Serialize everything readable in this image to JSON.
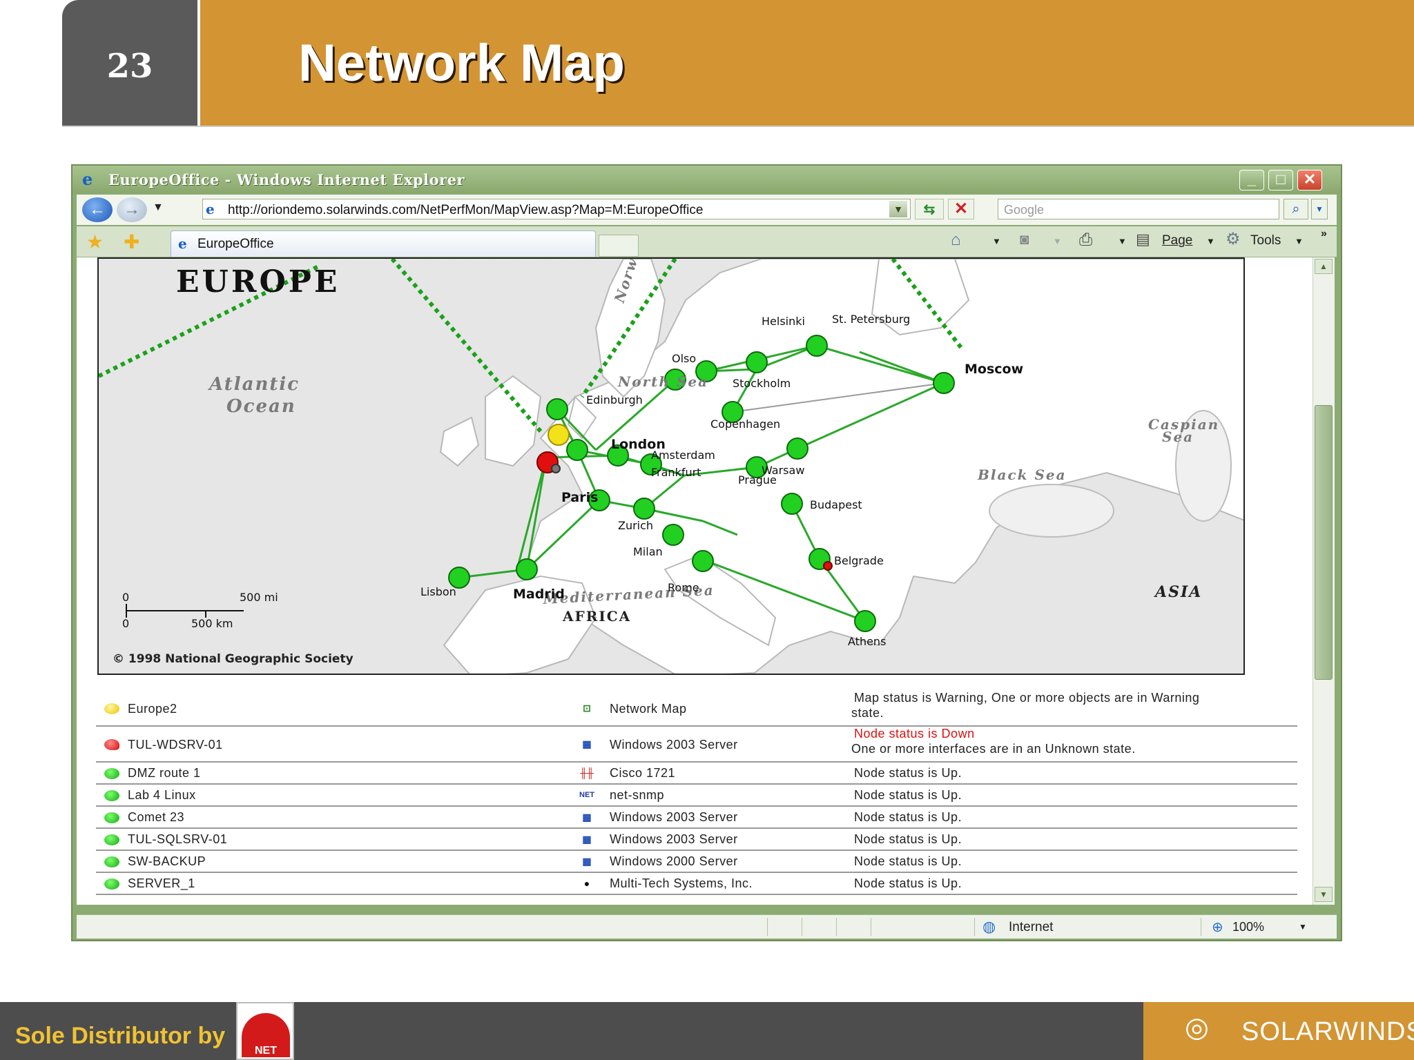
{
  "slide": {
    "number": "23",
    "title": "Network Map",
    "footer_text": "Sole Distributor by",
    "footer_logo_text": "NET",
    "brand": "SOLARWINDS",
    "colors": {
      "header": "#d39433",
      "dark": "#4d4d4d",
      "footer_text": "#f1c232"
    }
  },
  "browser": {
    "window_title": "EuropeOffice - Windows Internet Explorer",
    "url": "http://oriondemo.solarwinds.com/NetPerfMon/MapView.asp?Map=M:EuropeOffice",
    "search_placeholder": "Google",
    "tab_label": "EuropeOffice",
    "commands": {
      "page": "Page",
      "tools": "Tools",
      "more": "»"
    },
    "status": {
      "zone": "Internet",
      "zoom": "100%"
    }
  },
  "map": {
    "title": "EUROPE",
    "copyright": "© 1998 National Geographic Society",
    "scale": {
      "mi_zero": "0",
      "mi": "500 mi",
      "km_zero": "0",
      "km": "500 km"
    },
    "seas": [
      "Atlantic",
      "Ocean",
      "Norwegian Sea",
      "North Sea",
      "Caspian",
      "Sea",
      "Black Sea",
      "Mediterranean Sea",
      "AFRICA",
      "ASIA"
    ],
    "cities": {
      "edinburgh": "Edinburgh",
      "london": "London",
      "amsterdam": "Amsterdam",
      "frankfurt": "Frankfurt",
      "paris": "Paris",
      "zurich": "Zurich",
      "milan": "Milan",
      "rome": "Rome",
      "madrid": "Madrid",
      "lisbon": "Lisbon",
      "olso": "Olso",
      "stockholm": "Stockholm",
      "helsinki": "Helsinki",
      "st_petersburg": "St. Petersburg",
      "moscow": "Moscow",
      "copenhagen": "Copenhagen",
      "warsaw": "Warsaw",
      "prague": "Prague",
      "budapest": "Budapest",
      "belgrade": "Belgrade",
      "athens": "Athens"
    }
  },
  "nodes": [
    {
      "name": "Europe2",
      "status_color": "yellow",
      "type": "Network Map",
      "type_icon": "network-map-icon",
      "status": "Map status is Warning, One or more objects are in Warning",
      "status2": "state."
    },
    {
      "name": "TUL-WDSRV-01",
      "status_color": "red",
      "type": "Windows 2003 Server",
      "type_icon": "windows-icon",
      "status": "Node status is Down",
      "status2": "One or more interfaces are in an Unknown state."
    },
    {
      "name": "DMZ route 1",
      "status_color": "green",
      "type": "Cisco 1721",
      "type_icon": "cisco-icon",
      "status": "Node status is Up."
    },
    {
      "name": "Lab 4 Linux",
      "status_color": "green",
      "type": "net-snmp",
      "type_icon": "net-snmp-icon",
      "status": "Node status is Up."
    },
    {
      "name": "Comet 23",
      "status_color": "green",
      "type": "Windows 2003 Server",
      "type_icon": "windows-icon",
      "status": "Node status is Up."
    },
    {
      "name": "TUL-SQLSRV-01",
      "status_color": "green",
      "type": "Windows 2003 Server",
      "type_icon": "windows-icon",
      "status": "Node status is Up."
    },
    {
      "name": "SW-BACKUP",
      "status_color": "green",
      "type": "Windows 2000 Server",
      "type_icon": "windows-icon",
      "status": "Node status is Up."
    },
    {
      "name": "SERVER_1",
      "status_color": "green",
      "type": "Multi-Tech Systems, Inc.",
      "type_icon": "multitech-icon",
      "status": "Node status is Up."
    }
  ]
}
